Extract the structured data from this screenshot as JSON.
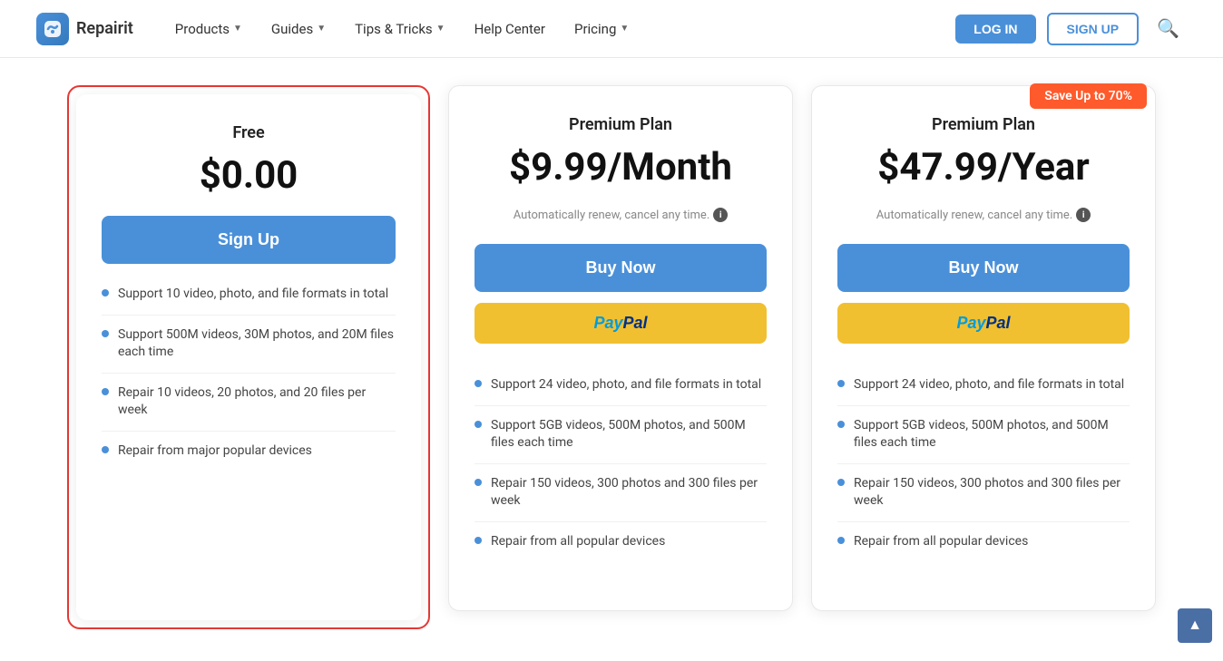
{
  "header": {
    "logo_text": "Repairit",
    "nav_items": [
      {
        "label": "Products",
        "has_dropdown": true
      },
      {
        "label": "Guides",
        "has_dropdown": true
      },
      {
        "label": "Tips & Tricks",
        "has_dropdown": true
      },
      {
        "label": "Help Center",
        "has_dropdown": false
      },
      {
        "label": "Pricing",
        "has_dropdown": true
      }
    ],
    "login_label": "LOG IN",
    "signup_label": "SIGN UP"
  },
  "pricing": {
    "save_badge": "Save Up to 70%",
    "plans": [
      {
        "id": "free",
        "name": "Free",
        "price": "$0.00",
        "renew_text": null,
        "cta_primary": "Sign Up",
        "has_paypal": false,
        "highlighted": true,
        "features": [
          "Support 10 video, photo, and file formats in total",
          "Support 500M videos, 30M photos, and 20M files each time",
          "Repair 10 videos, 20 photos, and 20 files per week",
          "Repair from major popular devices"
        ]
      },
      {
        "id": "premium_monthly",
        "name": "Premium Plan",
        "price": "$9.99/Month",
        "renew_text": "Automatically renew, cancel any time.",
        "cta_primary": "Buy Now",
        "has_paypal": true,
        "highlighted": false,
        "features": [
          "Support 24 video, photo, and file formats in total",
          "Support 5GB videos, 500M photos, and 500M files each time",
          "Repair 150 videos, 300 photos and 300 files per week",
          "Repair from all popular devices"
        ]
      },
      {
        "id": "premium_yearly",
        "name": "Premium Plan",
        "price": "$47.99/Year",
        "renew_text": "Automatically renew, cancel any time.",
        "cta_primary": "Buy Now",
        "has_paypal": true,
        "highlighted": false,
        "has_save_badge": true,
        "features": [
          "Support 24 video, photo, and file formats in total",
          "Support 5GB videos, 500M photos, and 500M files each time",
          "Repair 150 videos, 300 photos and 300 files per week",
          "Repair from all popular devices"
        ]
      }
    ]
  }
}
